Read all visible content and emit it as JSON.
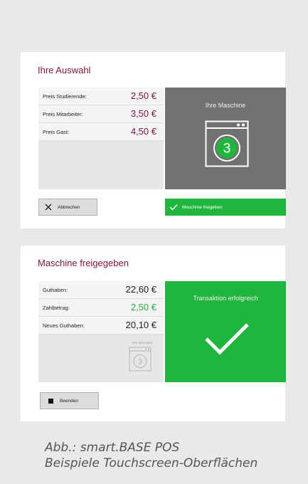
{
  "selection_panel": {
    "title": "Ihre Auswahl",
    "prices": [
      {
        "label": "Preis Studierende:",
        "value": "2,50 €"
      },
      {
        "label": "Preis Mitarbeiter:",
        "value": "3,50 €"
      },
      {
        "label": "Preis Gast:",
        "value": "4,50 €"
      }
    ],
    "machine_tile": {
      "title": "Ihre Maschine",
      "machine_number": "3"
    },
    "cancel_button": "Abbrechen",
    "release_button": "Maschine freigeben"
  },
  "released_panel": {
    "title": "Maschine freigegeben",
    "rows": [
      {
        "label": "Guthaben:",
        "value": "22,60 €"
      },
      {
        "label": "Zahlbetrag:",
        "value": "2,50 €"
      },
      {
        "label": "Neues Guthaben:",
        "value": "20,10 €"
      }
    ],
    "mini_machine": {
      "label": "Ihre Maschine",
      "machine_number": "3"
    },
    "success_tile": {
      "title": "Transaktion erfolgreich"
    },
    "exit_button": "Beenden"
  },
  "caption": {
    "line1": "Abb.: smart.BASE POS",
    "line2": "Beispiele Touchscreen-Oberflächen"
  },
  "colors": {
    "accent_title": "#8a1538",
    "price_value": "#8a1538",
    "highlight_green": "#20b53d",
    "machine_grey": "#717171"
  }
}
